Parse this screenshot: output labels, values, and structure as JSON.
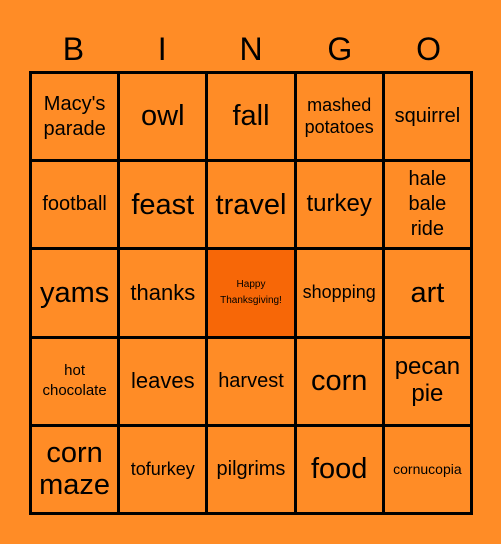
{
  "header": {
    "letters": [
      "B",
      "I",
      "N",
      "G",
      "O"
    ]
  },
  "colors": {
    "background": "#ff8c26",
    "free_cell": "#f76707",
    "grid_line": "#000000"
  },
  "board": {
    "rows": [
      [
        "Macy's parade",
        "owl",
        "fall",
        "mashed potatoes",
        "squirrel"
      ],
      [
        "football",
        "feast",
        "travel",
        "turkey",
        "hale bale ride"
      ],
      [
        "yams",
        "thanks",
        "Happy Thanksgiving!",
        "shopping",
        "art"
      ],
      [
        "hot chocolate",
        "leaves",
        "harvest",
        "corn",
        "pecan pie"
      ],
      [
        "corn maze",
        "tofurkey",
        "pilgrims",
        "food",
        "cornucopia"
      ]
    ],
    "free_space": {
      "row": 2,
      "col": 2
    }
  }
}
